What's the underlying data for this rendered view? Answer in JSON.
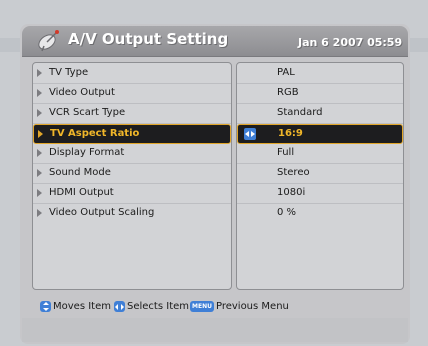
{
  "header": {
    "title": "A/V Output Setting",
    "datetime": "Jan 6 2007 05:59",
    "icon": "satellite-dish-icon"
  },
  "settings": [
    {
      "label": "TV Type",
      "value": "PAL"
    },
    {
      "label": "Video Output",
      "value": "RGB"
    },
    {
      "label": "VCR Scart Type",
      "value": "Standard"
    },
    {
      "label": "TV Aspect Ratio",
      "value": "16:9"
    },
    {
      "label": "Display Format",
      "value": "Full"
    },
    {
      "label": "Sound Mode",
      "value": "Stereo"
    },
    {
      "label": "HDMI Output",
      "value": "1080i"
    },
    {
      "label": "Video Output Scaling",
      "value": "0 %"
    }
  ],
  "selected_label": "TV Aspect Ratio",
  "help": {
    "move": "Moves Item",
    "select": "Selects Item",
    "menu_key": "MENU",
    "menu": "Previous Menu"
  },
  "colors": {
    "highlight_text": "#f0b629",
    "highlight_border": "#e1a62a",
    "key_blue": "#3f7fd6"
  }
}
